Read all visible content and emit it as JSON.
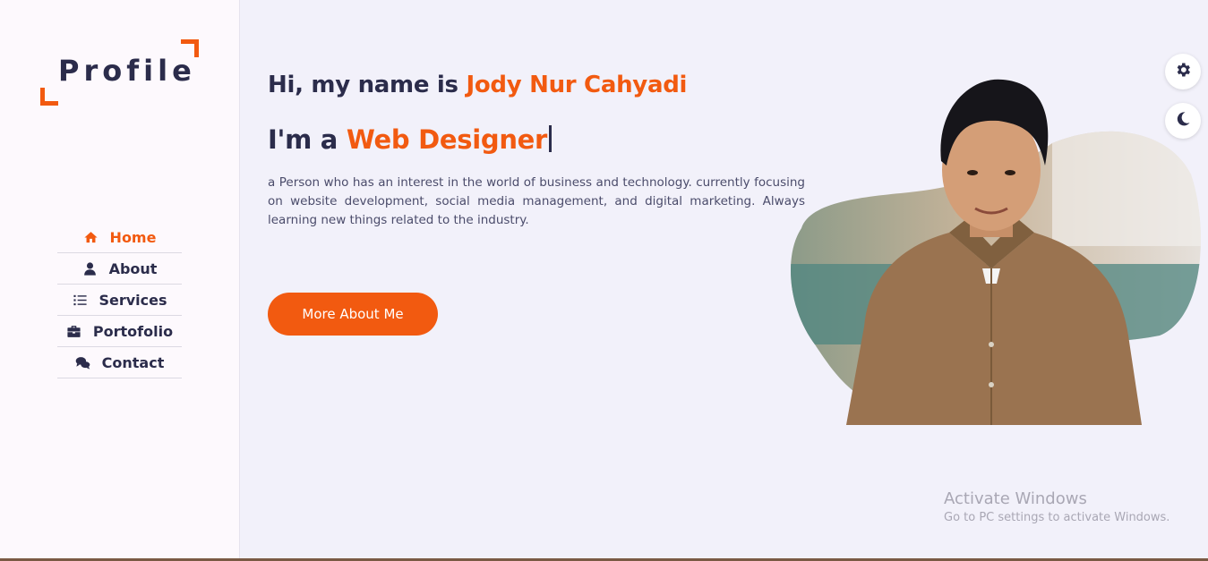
{
  "logo": {
    "text": "Profile"
  },
  "nav": {
    "items": [
      {
        "label": "Home",
        "icon": "home-icon",
        "active": true
      },
      {
        "label": "About",
        "icon": "user-icon",
        "active": false
      },
      {
        "label": "Services",
        "icon": "list-icon",
        "active": false
      },
      {
        "label": "Portofolio",
        "icon": "briefcase-icon",
        "active": false
      },
      {
        "label": "Contact",
        "icon": "chat-icon",
        "active": false
      }
    ]
  },
  "hero": {
    "greeting_prefix": "Hi, my name is ",
    "name": "Jody Nur Cahyadi",
    "role_prefix": "I'm a ",
    "role": "Web Designer",
    "description": "a Person who has an interest in the world of business and technology. currently focusing on website development, social media management, and digital marketing. Always learning new things related to the industry.",
    "cta_label": "More About Me"
  },
  "controls": {
    "settings_icon": "gear-icon",
    "theme_icon": "moon-icon"
  },
  "watermark": {
    "title": "Activate Windows",
    "subtitle": "Go to PC settings to activate Windows."
  },
  "colors": {
    "accent": "#f25a10",
    "text": "#2b2c4b",
    "background": "#f2f1fa",
    "sidebar": "#fdf9fd"
  }
}
